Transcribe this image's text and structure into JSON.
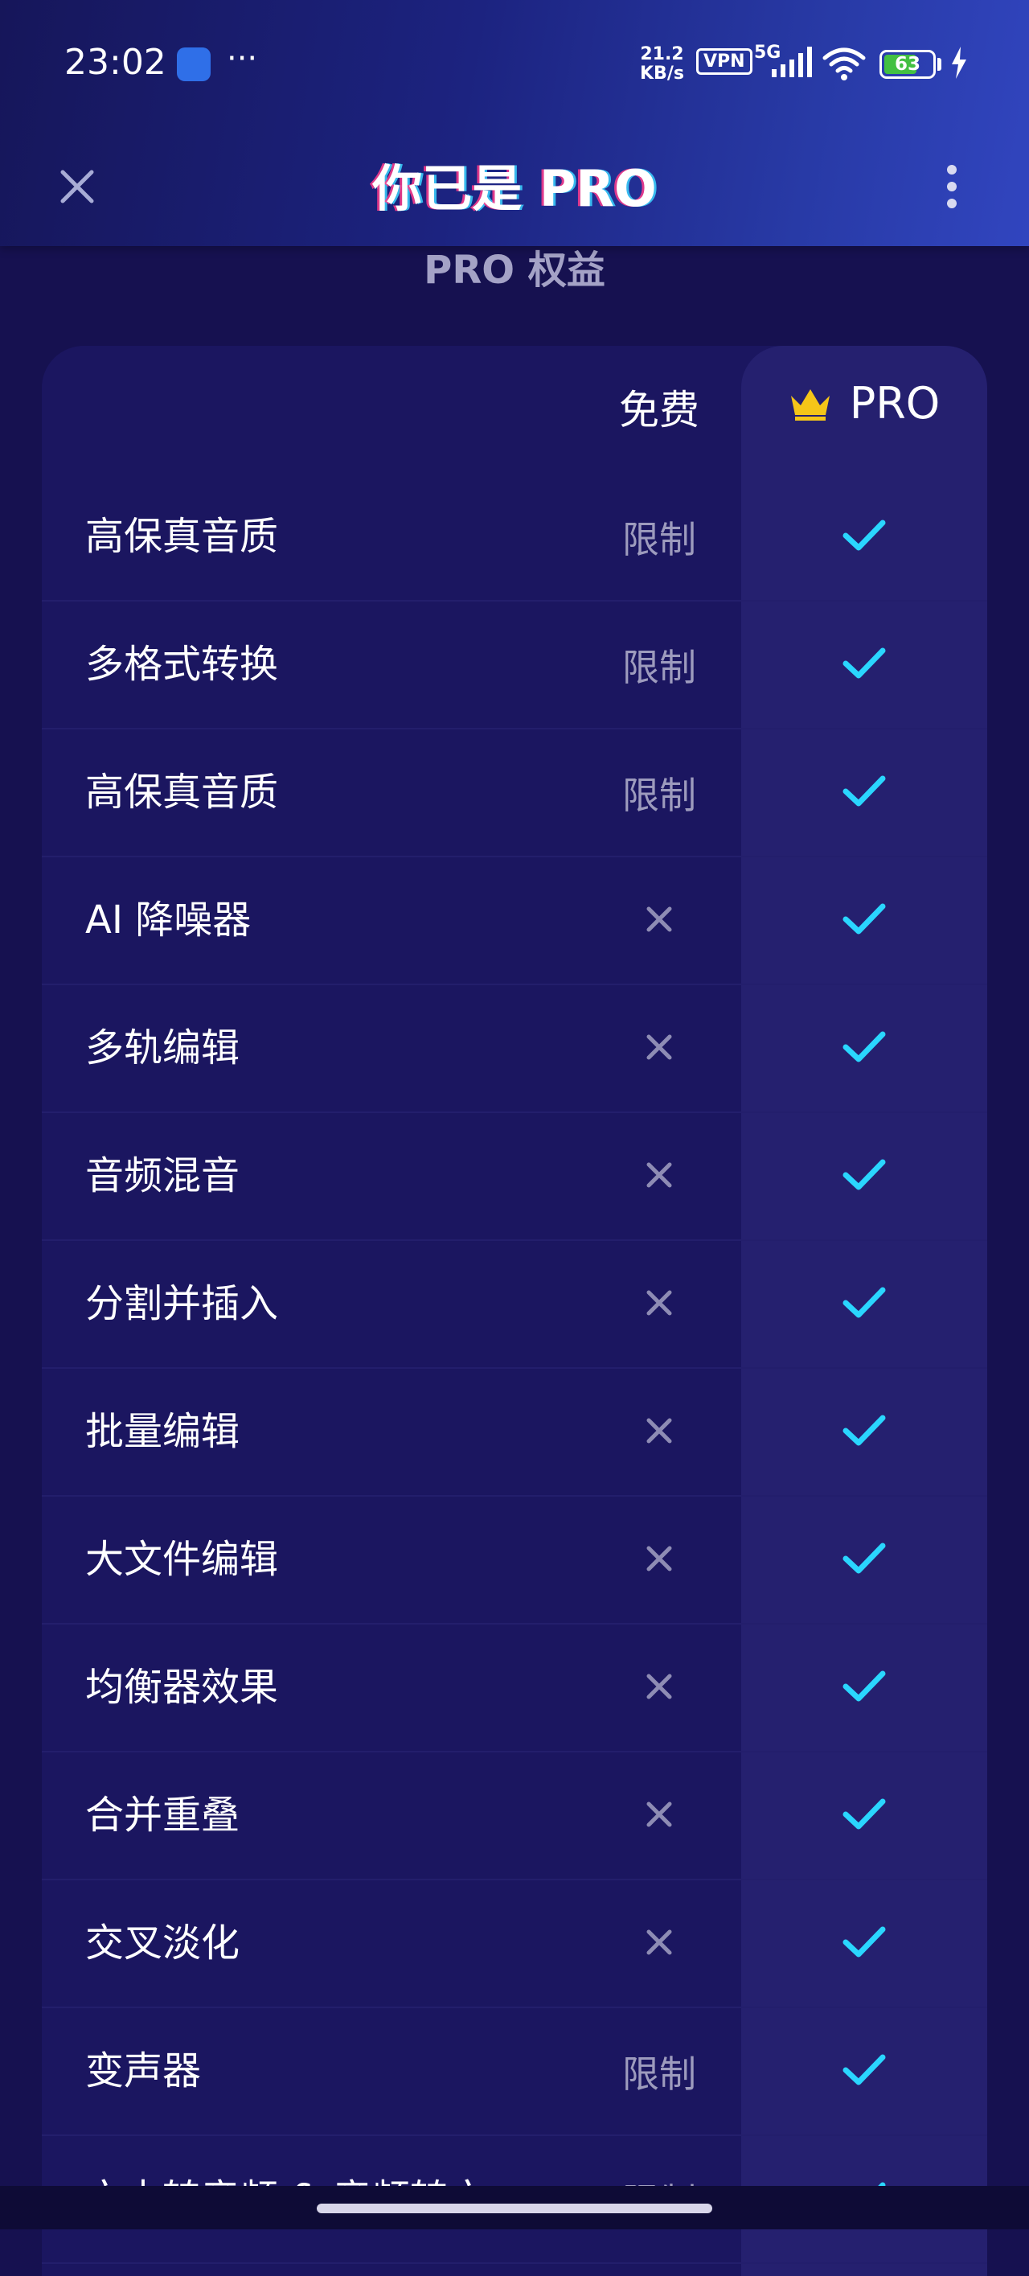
{
  "status_bar": {
    "time": "23:02",
    "more_dots": "···",
    "speed_value": "21.2",
    "speed_unit": "KB/s",
    "vpn": "VPN",
    "network": "5G",
    "battery": "63"
  },
  "header": {
    "title": "你已是 PRO",
    "close_icon": "close-icon",
    "more_icon": "more-vertical-icon"
  },
  "section_title": "PRO 权益",
  "table": {
    "col_free": "免费",
    "col_pro": "PRO",
    "pro_icon": "crown-icon",
    "rows": [
      {
        "feature": "高保真音质",
        "free": "限制",
        "pro": "check"
      },
      {
        "feature": "多格式转换",
        "free": "限制",
        "pro": "check"
      },
      {
        "feature": "高保真音质",
        "free": "限制",
        "pro": "check"
      },
      {
        "feature": "AI 降噪器",
        "free": "cross",
        "pro": "check"
      },
      {
        "feature": "多轨编辑",
        "free": "cross",
        "pro": "check"
      },
      {
        "feature": "音频混音",
        "free": "cross",
        "pro": "check"
      },
      {
        "feature": "分割并插入",
        "free": "cross",
        "pro": "check"
      },
      {
        "feature": "批量编辑",
        "free": "cross",
        "pro": "check"
      },
      {
        "feature": "大文件编辑",
        "free": "cross",
        "pro": "check"
      },
      {
        "feature": "均衡器效果",
        "free": "cross",
        "pro": "check"
      },
      {
        "feature": "合并重叠",
        "free": "cross",
        "pro": "check"
      },
      {
        "feature": "交叉淡化",
        "free": "cross",
        "pro": "check"
      },
      {
        "feature": "变声器",
        "free": "限制",
        "pro": "check"
      },
      {
        "feature": "文本转音频 & 音频转文",
        "free": "限制",
        "pro": "check"
      }
    ]
  },
  "colors": {
    "background": "#161150",
    "table_bg": "#1b1660",
    "pro_column_bg": "#25206f",
    "check": "#2ad6ff",
    "cross": "#8e8cb4",
    "crown": "#f5c518"
  }
}
